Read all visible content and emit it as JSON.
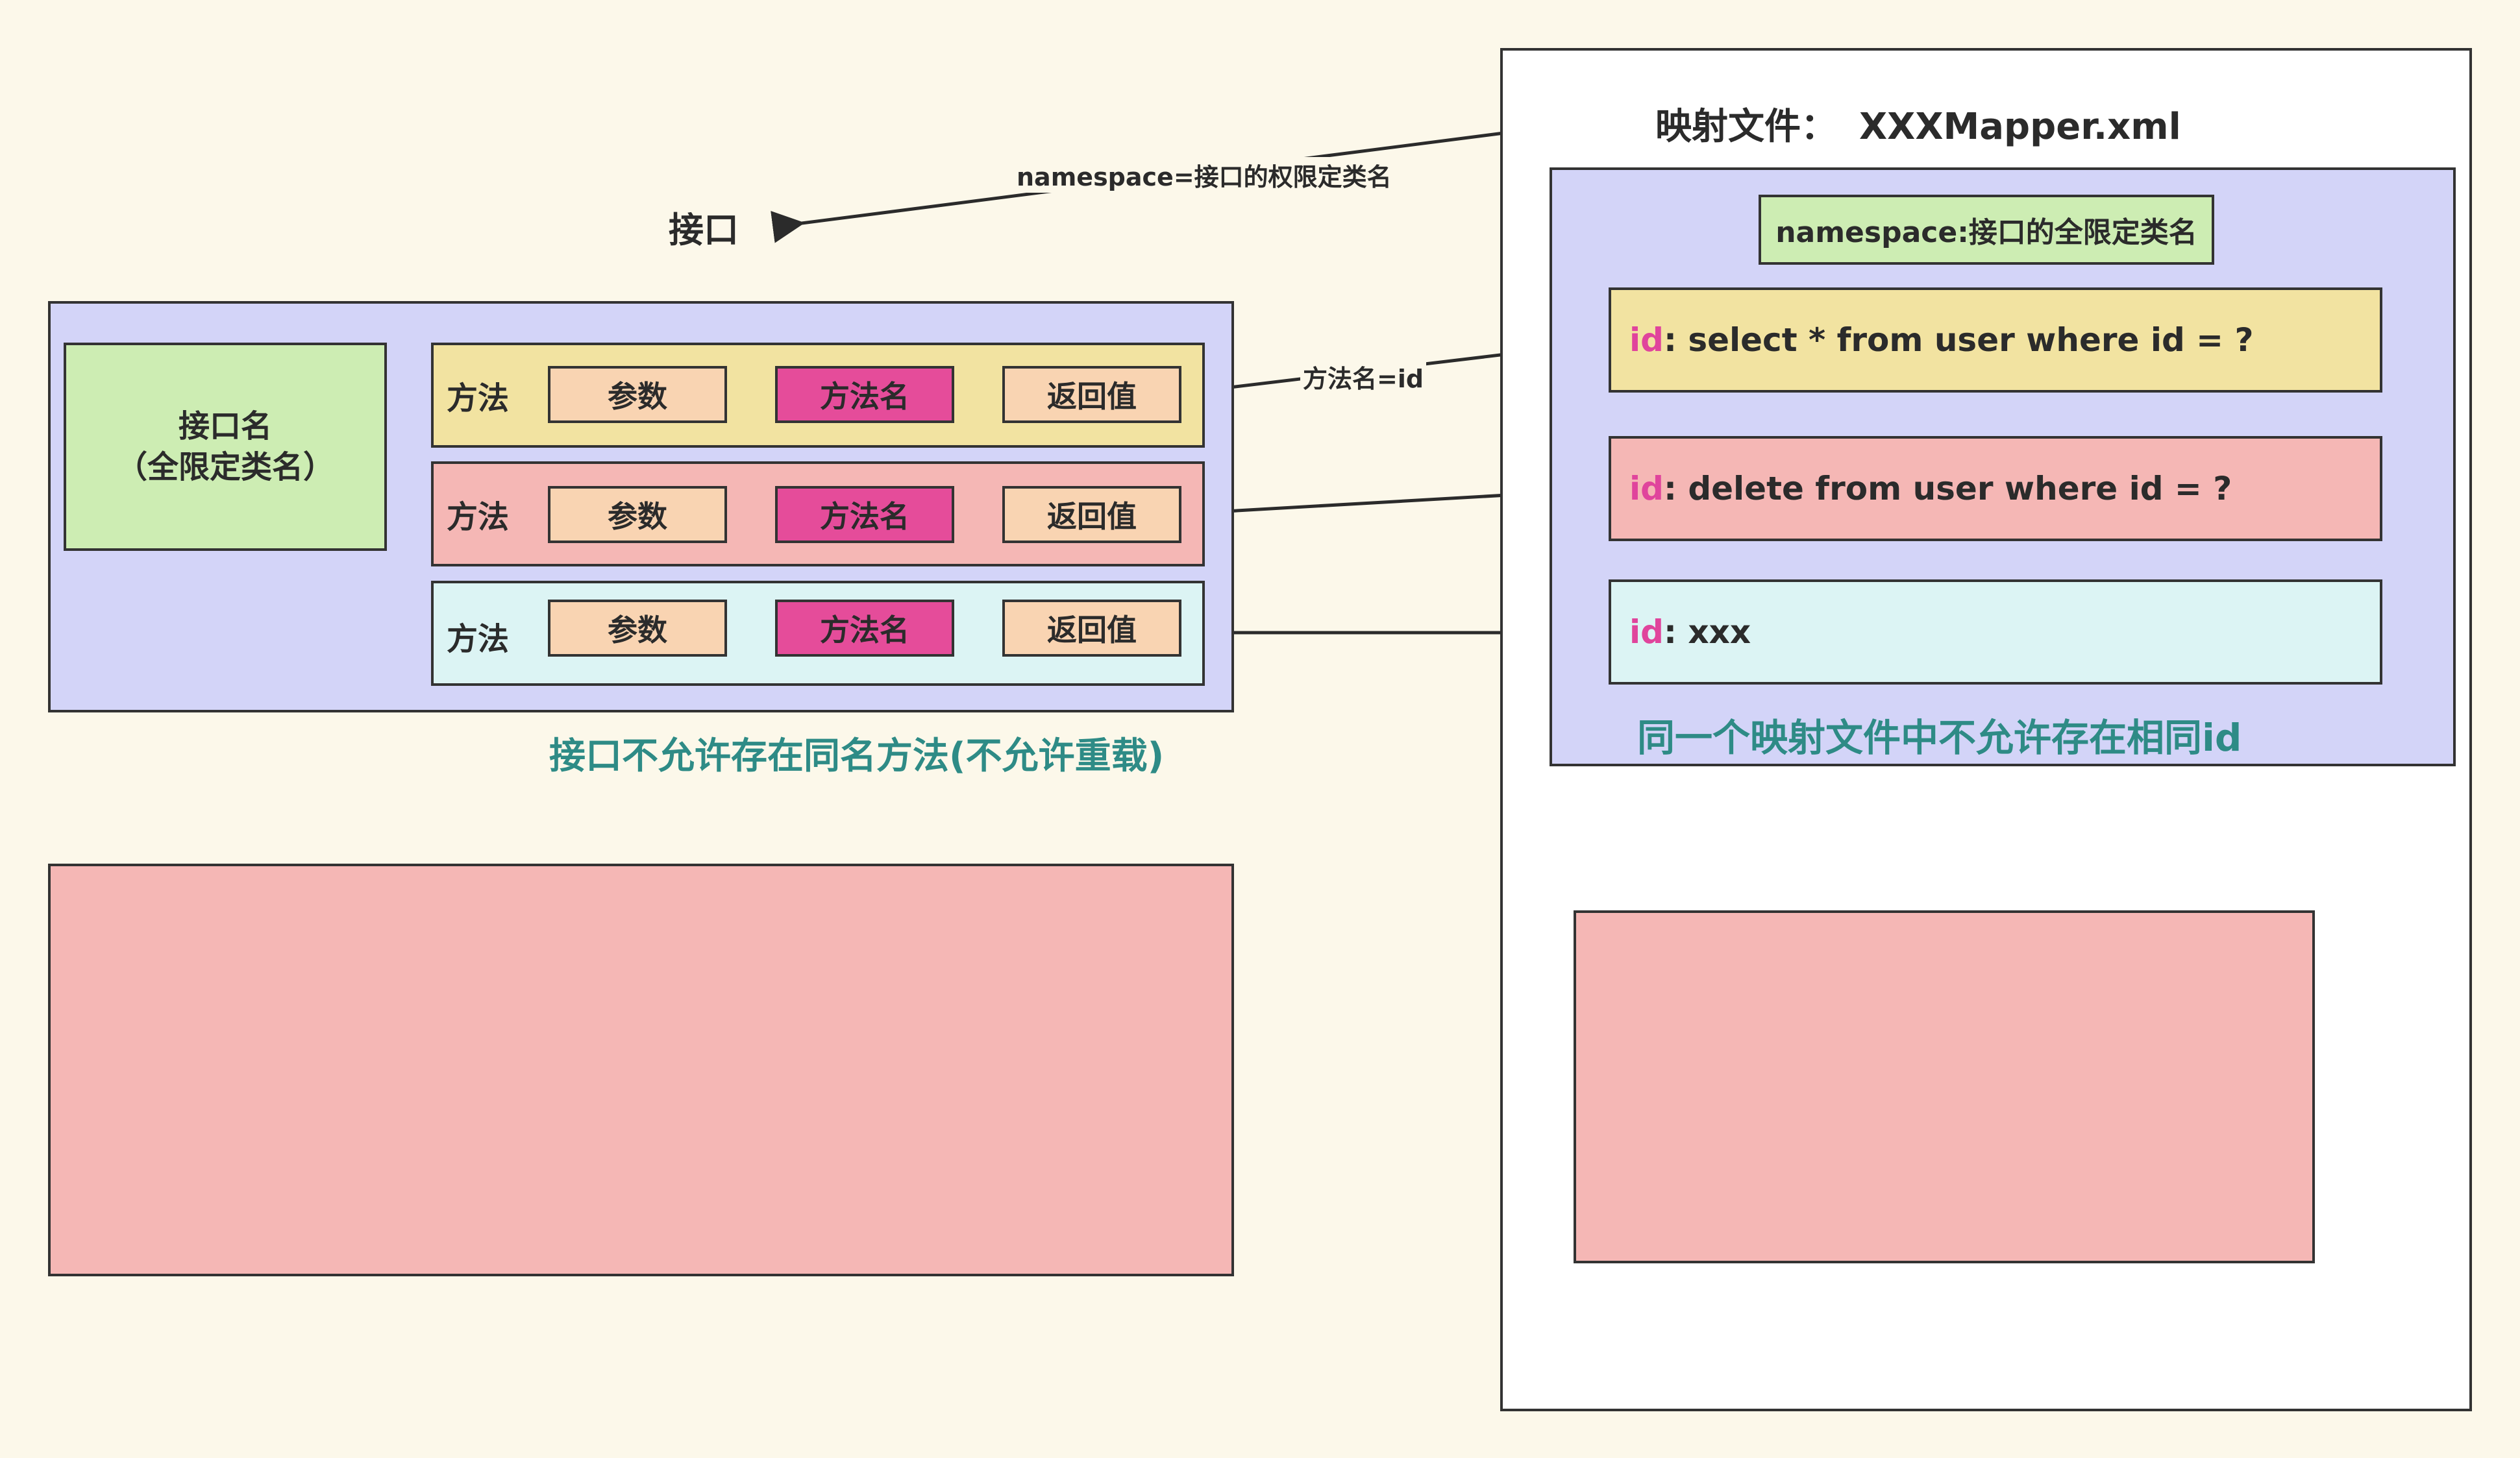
{
  "interface_label": "接口",
  "namespace_arrow_label": "namespace=接口的权限定类名",
  "method_id_arrow_label": "方法名=id",
  "interface_name": {
    "line1": "接口名",
    "line2": "（全限定类名）"
  },
  "method_rows": [
    {
      "label": "方法",
      "params": "参数",
      "name": "方法名",
      "return": "返回值"
    },
    {
      "label": "方法",
      "params": "参数",
      "name": "方法名",
      "return": "返回值"
    },
    {
      "label": "方法",
      "params": "参数",
      "name": "方法名",
      "return": "返回值"
    }
  ],
  "interface_caption": "接口不允许存在同名方法(不允许重载)",
  "mapper_title_label": "映射文件：",
  "mapper_file_name": "XXXMapper.xml",
  "namespace_box": "namespace:接口的全限定类名",
  "statements": [
    {
      "key": "id",
      "sql": ": select * from user where id = ?"
    },
    {
      "key": "id",
      "sql": ": delete from user where id = ?"
    },
    {
      "key": "id",
      "sql": ": xxx"
    }
  ],
  "mapper_caption": "同一个映射文件中不允许存在相同id",
  "colors": {
    "background": "#fcf8ea",
    "blue_panel": "#d3d4f8",
    "green_box": "#cdedb3",
    "yellow_row": "#f2e3a1",
    "pink_row": "#f5b7b5",
    "cyan_row": "#dcf4f4",
    "param_box": "#f9d4b2",
    "method_name_box": "#e54c9a",
    "caption_teal": "#2e8b86",
    "id_magenta": "#e0449c"
  }
}
